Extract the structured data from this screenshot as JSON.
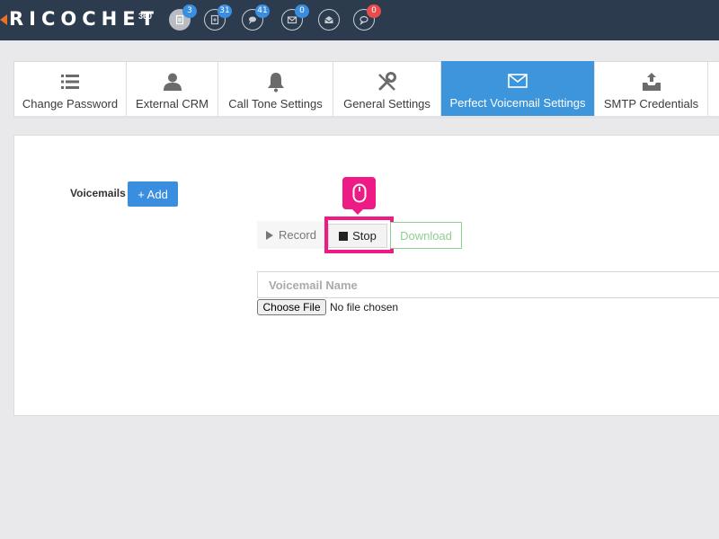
{
  "app": {
    "logo_text": "RICOCHET",
    "logo_sup": "360"
  },
  "header_icons": [
    {
      "name": "documents-icon",
      "badge": "3",
      "badge_color": "#3a8ee0"
    },
    {
      "name": "plus-doc-icon",
      "badge": "31",
      "badge_color": "#3a8ee0"
    },
    {
      "name": "chat-icon",
      "badge": "41",
      "badge_color": "#3a8ee0"
    },
    {
      "name": "mail-icon",
      "badge": "0",
      "badge_color": "#3a8ee0"
    },
    {
      "name": "open-mail-icon",
      "badge": "",
      "badge_color": ""
    },
    {
      "name": "comment-icon",
      "badge": "0",
      "badge_color": "#e74c4c"
    }
  ],
  "tabs": [
    {
      "label": "Change Password",
      "icon": "list-icon"
    },
    {
      "label": "External CRM",
      "icon": "user-icon"
    },
    {
      "label": "Call Tone Settings",
      "icon": "bell-icon"
    },
    {
      "label": "General Settings",
      "icon": "wrench-icon"
    },
    {
      "label": "Perfect Voicemail Settings",
      "icon": "envelope-icon",
      "active": true
    },
    {
      "label": "SMTP Credentials",
      "icon": "inbox-upload-icon"
    }
  ],
  "voicemails": {
    "label": "Voicemails",
    "add_label": "+ Add",
    "record_label": "Record",
    "stop_label": "Stop",
    "download_label": "Download",
    "name_placeholder": "Voicemail Name",
    "file_button": "Choose File",
    "file_status": "No file chosen"
  },
  "colors": {
    "topbar": "#2c3b4d",
    "accent": "#3d95db",
    "highlight": "#ee1a86",
    "download": "#8fcf8f"
  }
}
